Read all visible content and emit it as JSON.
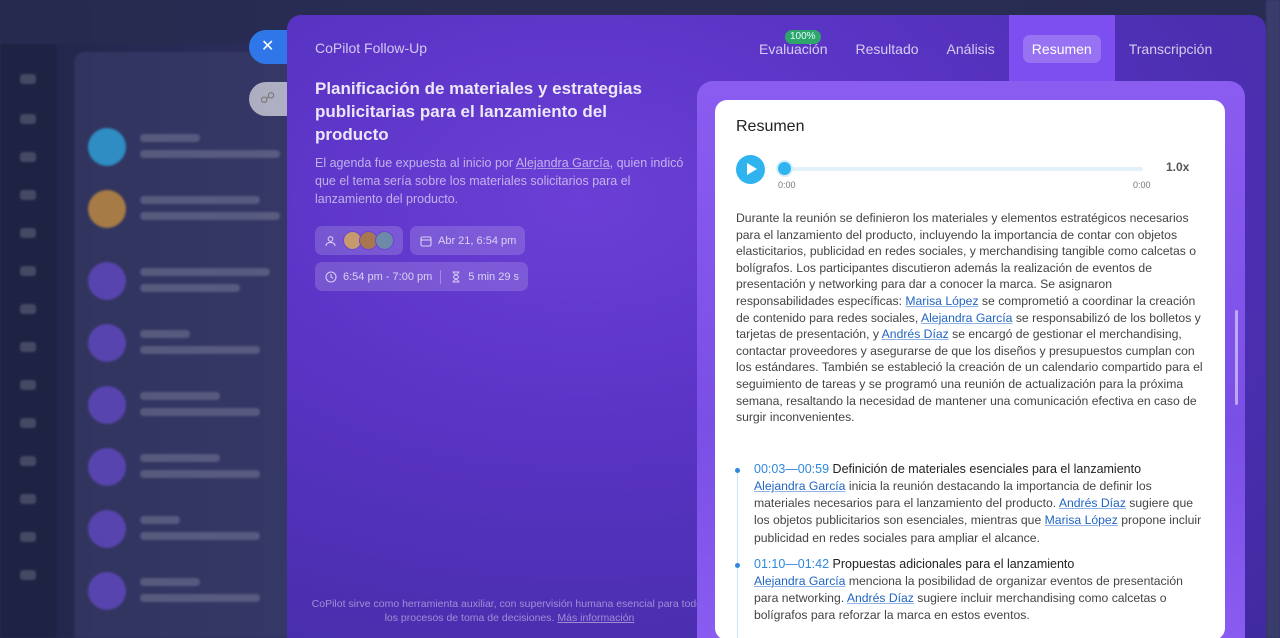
{
  "background": {
    "close_icon": "✕",
    "link_icon": "🔗"
  },
  "modal": {
    "title": "CoPilot Follow-Up",
    "tabs": [
      {
        "label": "Evaluación",
        "badge": "100%",
        "active": false
      },
      {
        "label": "Resultado",
        "active": false
      },
      {
        "label": "Análisis",
        "active": false
      },
      {
        "label": "Resumen",
        "active": true
      },
      {
        "label": "Transcripción",
        "active": false
      }
    ]
  },
  "meeting": {
    "title": "Planificación de materiales y estrategias publicitarias para el lanzamiento del producto",
    "desc_before": "El agenda fue expuesta al inicio por ",
    "desc_person": "Alejandra García",
    "desc_after": ", quien indicó que el tema sería sobre los materiales solicitarios para el lanzamiento del producto.",
    "participants_icon": "participants-icon",
    "avatar_colors": [
      "#c69a6e",
      "#a8774f",
      "#6d8aa8"
    ],
    "date": "Abr 21, 6:54 pm",
    "time_range": "6:54 pm - 7:00 pm",
    "duration": "5 min 29 s"
  },
  "disclaimer": {
    "text": "CoPilot sirve como herramienta auxiliar, con supervisión humana esencial para todos los procesos de toma de decisiones. ",
    "link": "Más información"
  },
  "summary": {
    "title": "Resumen",
    "player": {
      "current": "0:00",
      "total": "0:00",
      "speed": "1.0x"
    },
    "p1": "Durante la reunión se definieron los materiales y elementos estratégicos necesarios para el lanzamiento del producto, incluyendo la importancia de contar con objetos elasticitarios, publicidad en redes sociales, y merchandising tangible como calcetas o bolígrafos. Los participantes discutieron además la realización de eventos de presentación y networking para dar a conocer la marca. Se asignaron responsabilidades específicas: ",
    "n1": "Marisa López",
    "p2": " se comprometió a coordinar la creación de contenido para redes sociales, ",
    "n2": "Alejandra García",
    "p3": " se responsabilizó de los bolletos y tarjetas de presentación, y ",
    "n3": "Andrés Díaz",
    "p4": " se encargó de gestionar el merchandising, contactar proveedores y asegurarse de que los diseños y presupuestos cumplan con los estándares. También se estableció la creación de un calendario compartido para el seguimiento de tareas y se programó una reunión de actualización para la próxima semana, resaltando la necesidad de mantener una comunicación efectiva en caso de surgir inconvenientes.",
    "timeline": [
      {
        "time": "00:03—00:59",
        "title": " Definición de materiales esenciales para el lanzamiento",
        "a": "Alejandra García",
        "b": " inicia la reunión destacando la importancia de definir los materiales necesarios para el lanzamiento del producto. ",
        "c": "Andrés Díaz",
        "d": " sugiere que los objetos publicitarios son esenciales, mientras que ",
        "e": "Marisa López",
        "f": " propone incluir publicidad en redes sociales para ampliar el alcance."
      },
      {
        "time": "01:10—01:42",
        "title": " Propuestas adicionales para el lanzamiento",
        "a": "Alejandra García",
        "b": " menciona la posibilidad de organizar eventos de presentación para networking. ",
        "c": "Andrés Díaz",
        "d": " sugiere incluir merchandising como calcetas o bolígrafos para reforzar la marca en estos eventos."
      }
    ]
  }
}
